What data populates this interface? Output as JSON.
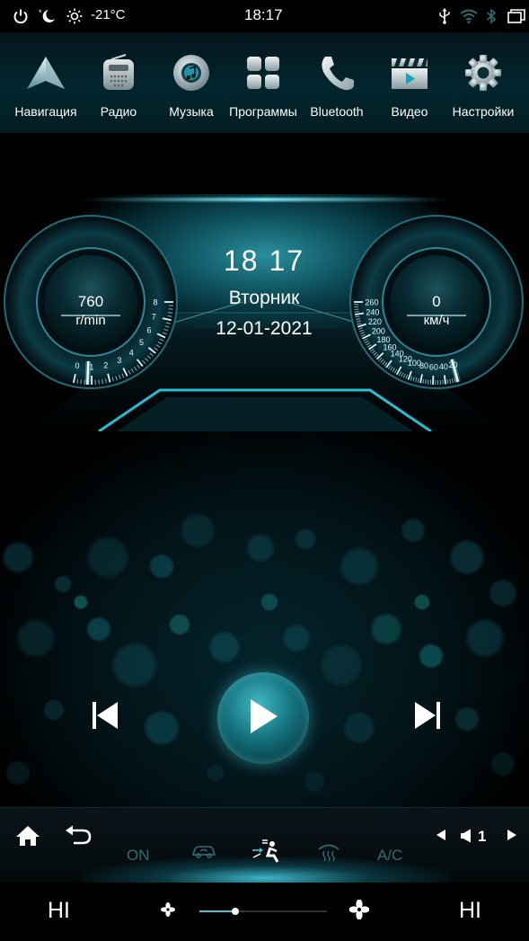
{
  "status_bar": {
    "temperature": "-21°C",
    "time": "18:17",
    "icons": [
      "power-icon",
      "night-mode-icon",
      "brightness-icon",
      "usb-icon",
      "wifi-icon",
      "bluetooth-icon",
      "recent-apps-icon"
    ]
  },
  "apps": [
    {
      "label": "Навигация",
      "icon": "navigation-icon"
    },
    {
      "label": "Радио",
      "icon": "radio-icon"
    },
    {
      "label": "Музыка",
      "icon": "music-icon"
    },
    {
      "label": "Программы",
      "icon": "apps-grid-icon"
    },
    {
      "label": "Bluetooth",
      "icon": "phone-icon"
    },
    {
      "label": "Видео",
      "icon": "video-icon"
    },
    {
      "label": "Настройки",
      "icon": "gear-icon"
    }
  ],
  "dashboard": {
    "time": "18 17",
    "day": "Вторник",
    "date": "12-01-2021",
    "tachometer": {
      "value": "760",
      "unit": "r/min",
      "ticks": [
        "0",
        "1",
        "2",
        "3",
        "4",
        "5",
        "6",
        "7",
        "8"
      ],
      "level": 0.095
    },
    "speedometer": {
      "value": "0",
      "unit": "км/ч",
      "ticks": [
        "20",
        "40",
        "60",
        "80",
        "100",
        "120",
        "140",
        "160",
        "180",
        "200",
        "220",
        "240",
        "260"
      ],
      "level": 0
    }
  },
  "media": {
    "prev": "skip-previous-icon",
    "play": "play-icon",
    "next": "skip-next-icon"
  },
  "bottom_bar": {
    "on_label": "ON",
    "ac_label": "A/C",
    "volume_value": "1"
  },
  "climate": {
    "left_temp": "HI",
    "right_temp": "HI",
    "fan_level": 0.28
  },
  "colors": {
    "accent": "#3ac7e0",
    "dim_accent": "#2c6f7c"
  }
}
